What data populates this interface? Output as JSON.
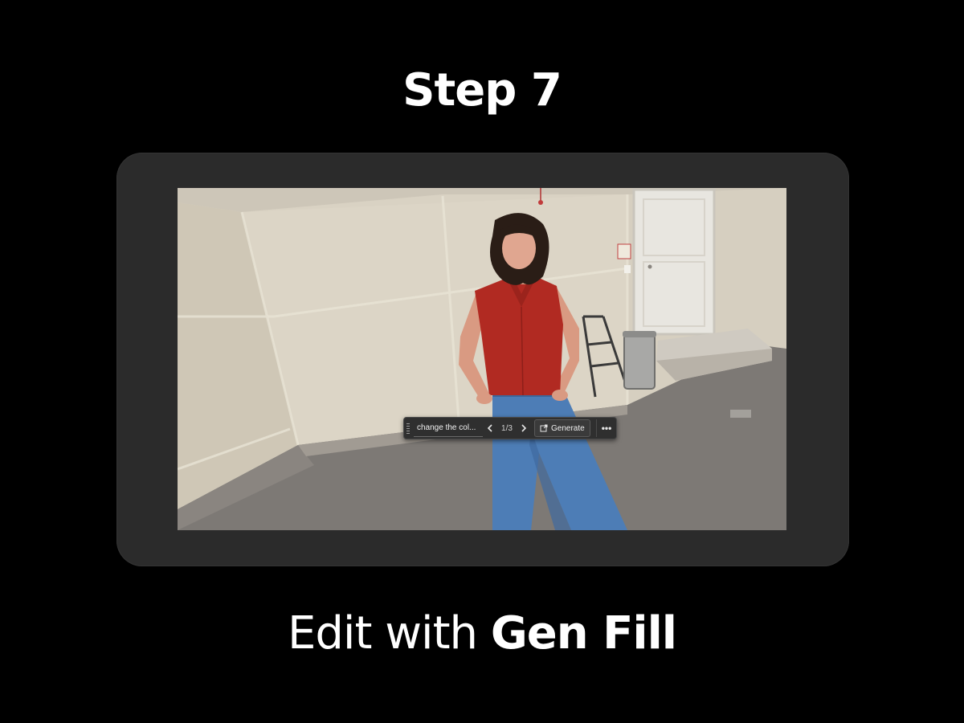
{
  "heading": "Step 7",
  "caption": {
    "light": "Edit with ",
    "bold": "Gen Fill"
  },
  "taskbar": {
    "prompt_value": "change the col...",
    "prev_icon": "chevron-left-icon",
    "next_icon": "chevron-right-icon",
    "counter": "1/3",
    "generate_label": "Generate",
    "generate_icon": "generate-icon",
    "more_icon": "more-dots-icon",
    "more_label": "•••"
  },
  "colors": {
    "background": "#000000",
    "frame": "#2b2b2b",
    "shirt": "#b22a22",
    "jeans": "#4f7fb8",
    "wall": "#d9d2c3",
    "floor": "#7a7673"
  }
}
